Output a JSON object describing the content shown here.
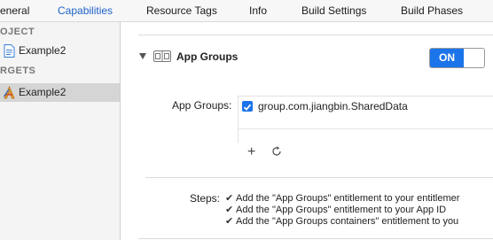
{
  "tabs": [
    {
      "label": "eneral"
    },
    {
      "label": "Capabilities"
    },
    {
      "label": "Resource Tags"
    },
    {
      "label": "Info"
    },
    {
      "label": "Build Settings"
    },
    {
      "label": "Build Phases"
    }
  ],
  "colors": {
    "accent": "#1b74ea",
    "active_tab": "#1d62c9"
  },
  "sidebar": {
    "project_header": "OJECT",
    "project_item": "Example2",
    "targets_header": "RGETS",
    "target_item": "Example2"
  },
  "capability": {
    "title": "App Groups",
    "toggle_label": "ON",
    "field_label": "App Groups:",
    "groups": [
      "group.com.jiangbin.SharedData"
    ],
    "add_icon": "+",
    "refresh_icon": "refresh-icon"
  },
  "steps": {
    "label": "Steps:",
    "check": "✔",
    "items": [
      "Add the \"App Groups\" entitlement to your entitlemer",
      "Add the \"App Groups\" entitlement to your App ID",
      "Add the \"App Groups containers\" entitlement to you"
    ]
  }
}
